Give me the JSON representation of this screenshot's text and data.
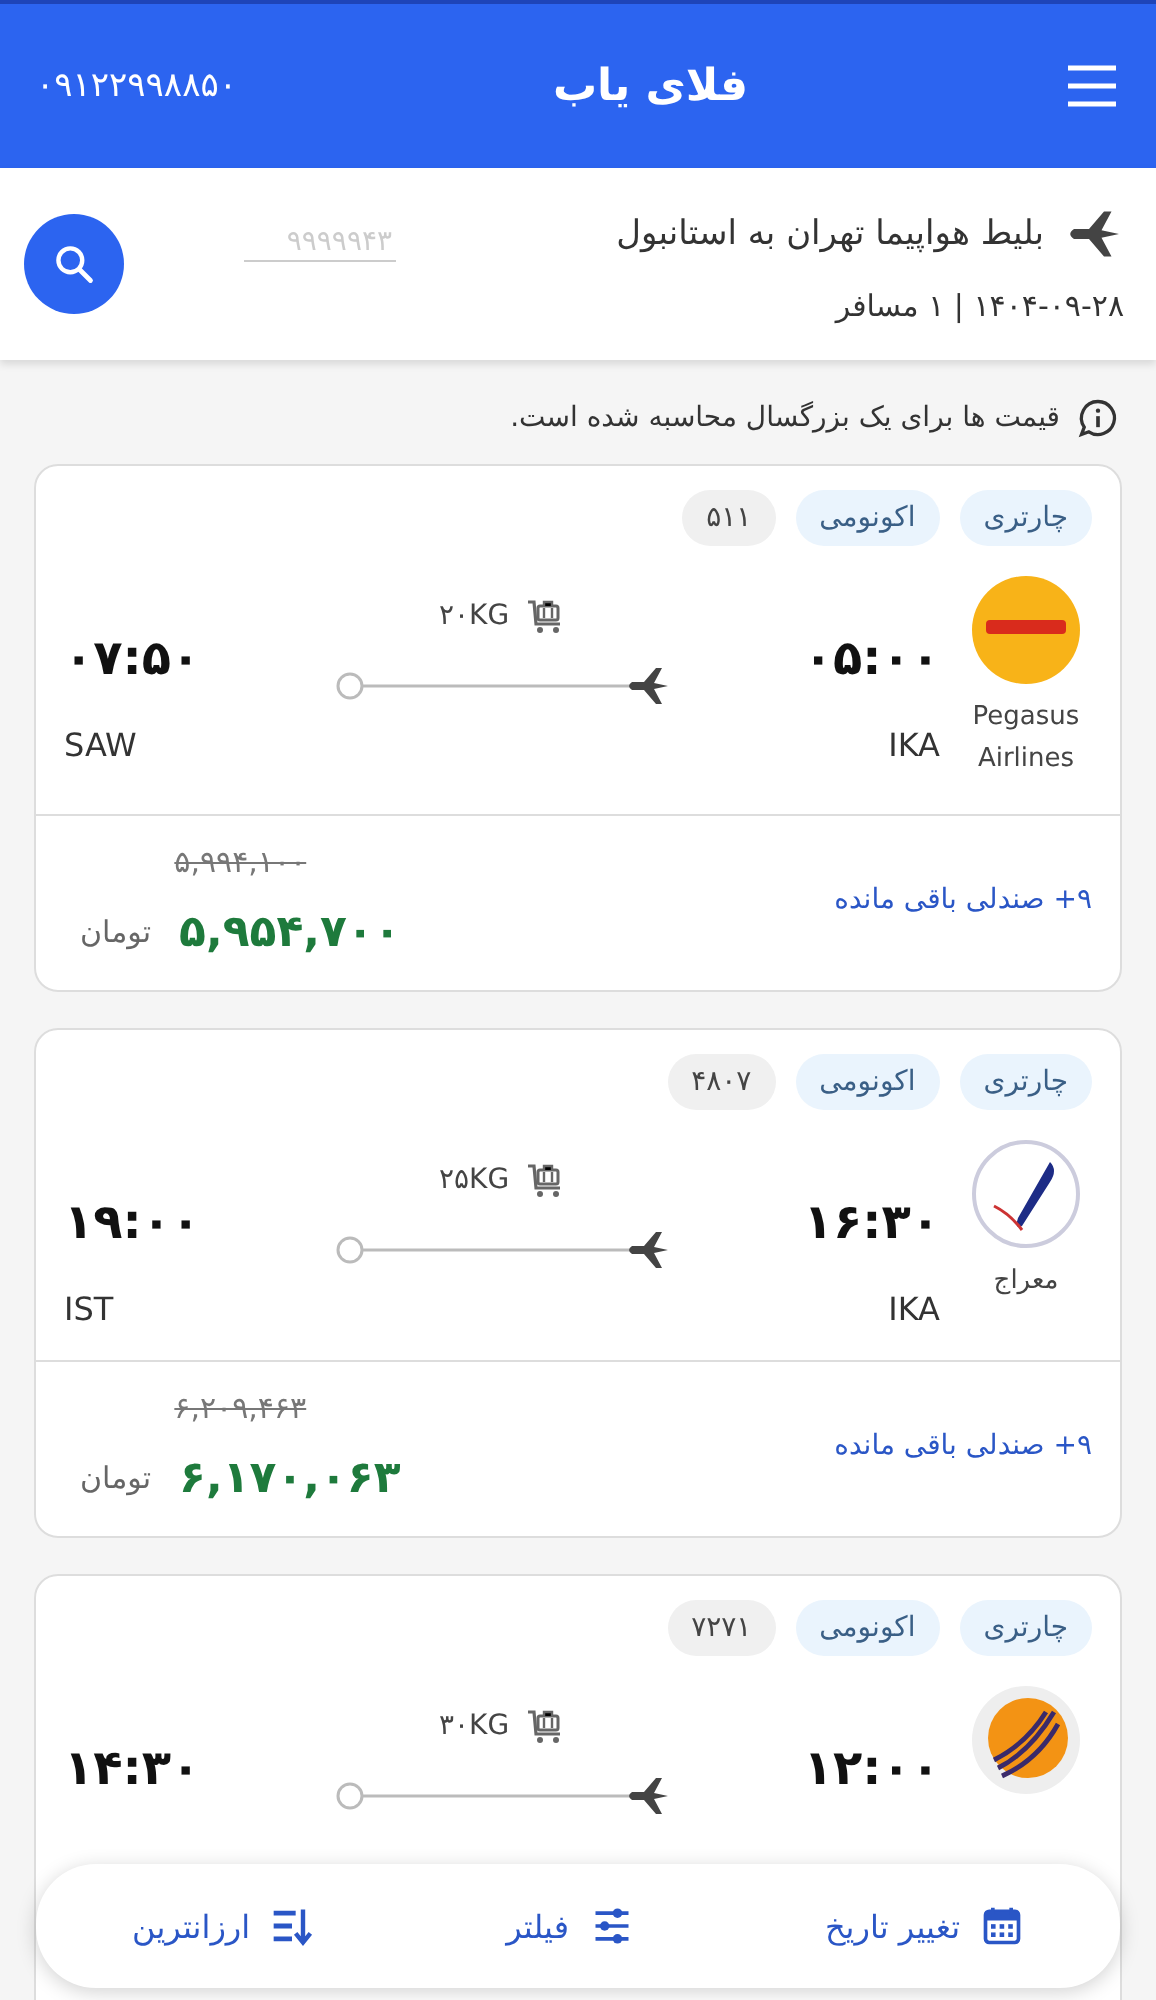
{
  "app_bar": {
    "title": "فلای یاب",
    "phone": "۰۹۱۲۲۹۹۸۸۵۰"
  },
  "search": {
    "title": "بلیط هواپیما تهران به استانبول",
    "subtitle": "۱۴۰۴-۰۹-۲۸ | ۱ مسافر",
    "field": {
      "placeholder": "۹۹۹۹۹۴۳"
    }
  },
  "notice": "قیمت ها برای یک بزرگسال محاسبه شده است.",
  "flights": [
    {
      "tags": [
        "چارتری",
        "اکونومی"
      ],
      "flight_number": "۵۱۱",
      "airline": {
        "kind": "pegasus",
        "name": "Pegasus Airlines"
      },
      "depart_time": "۰۵:۰۰",
      "depart_code": "IKA",
      "arrive_time": "۰۷:۵۰",
      "arrive_code": "SAW",
      "baggage": "۲۰KG",
      "seats": "۹+ صندلی باقی مانده",
      "old_price": "۵,۹۹۴,۱۰۰",
      "price": "۵,۹۵۴,۷۰۰",
      "currency": "تومان"
    },
    {
      "tags": [
        "چارتری",
        "اکونومی"
      ],
      "flight_number": "۴۸۰۷",
      "airline": {
        "kind": "meraj",
        "name": "معراج"
      },
      "depart_time": "۱۶:۳۰",
      "depart_code": "IKA",
      "arrive_time": "۱۹:۰۰",
      "arrive_code": "IST",
      "baggage": "۲۵KG",
      "seats": "۹+ صندلی باقی مانده",
      "old_price": "۶,۲۰۹,۴۶۳",
      "price": "۶,۱۷۰,۰۶۳",
      "currency": "تومان"
    },
    {
      "tags": [
        "چارتری",
        "اکونومی"
      ],
      "flight_number": "۷۲۷۱",
      "airline": {
        "kind": "orange"
      },
      "depart_time": "۱۲:۰۰",
      "arrive_time": "۱۴:۳۰",
      "baggage": "۳۰KG"
    }
  ],
  "bottom_bar": [
    {
      "kind": "calendar",
      "label": "تغییر تاریخ"
    },
    {
      "kind": "filter",
      "label": "فیلتر"
    },
    {
      "kind": "sort",
      "label": "ارزانترین"
    }
  ]
}
